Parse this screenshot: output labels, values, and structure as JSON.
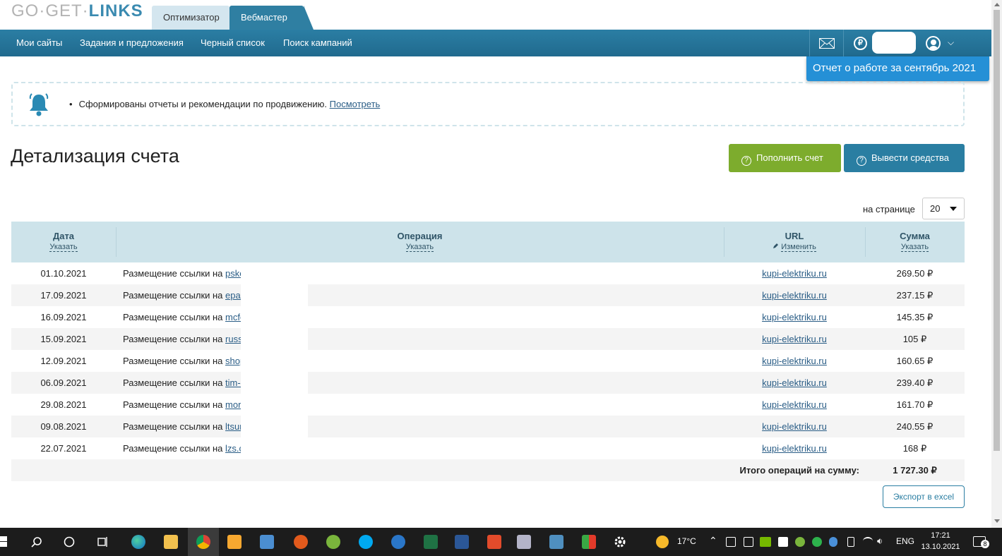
{
  "logo": {
    "part1": "GO·GET·",
    "part2": "LINKS"
  },
  "tabs": {
    "optimizer": "Оптимизатор",
    "webmaster": "Вебмастер"
  },
  "nav": [
    "Мои сайты",
    "Задания и предложения",
    "Черный список",
    "Поиск кампаний"
  ],
  "header_right": {
    "currency_symbol": "₽",
    "user_chevron": "⌵"
  },
  "report_popup": "Отчет о работе за сентябрь 2021",
  "notice": {
    "text": "Сформированы отчеты и рекомендации по продвижению.",
    "link": "Посмотреть"
  },
  "page_title": "Детализация счета",
  "buttons": {
    "topup": "Пополнить счет",
    "withdraw": "Вывести средства",
    "export": "Экспорт в excel"
  },
  "per_page": {
    "label": "на странице",
    "value": "20"
  },
  "table": {
    "headers": {
      "date": "Дата",
      "date_sub": "Указать",
      "operation": "Операция",
      "operation_sub": "Указать",
      "url": "URL",
      "url_sub": "Изменить",
      "sum": "Сумма",
      "sum_sub": "Указать"
    },
    "rows": [
      {
        "date": "01.10.2021",
        "op": "Размещение ссылки на ",
        "site": "psko",
        "url": "kupi-elektriku.ru",
        "sum": "269.50 ₽"
      },
      {
        "date": "17.09.2021",
        "op": "Размещение ссылки на ",
        "site": "epat",
        "url": "kupi-elektriku.ru",
        "sum": "237.15 ₽"
      },
      {
        "date": "16.09.2021",
        "op": "Размещение ссылки на ",
        "site": "mcfe",
        "url": "kupi-elektriku.ru",
        "sum": "145.35 ₽"
      },
      {
        "date": "15.09.2021",
        "op": "Размещение ссылки на ",
        "site": "russ",
        "url": "kupi-elektriku.ru",
        "sum": "105 ₽"
      },
      {
        "date": "12.09.2021",
        "op": "Размещение ссылки на ",
        "site": "shop",
        "url": "kupi-elektriku.ru",
        "sum": "160.65 ₽"
      },
      {
        "date": "06.09.2021",
        "op": "Размещение ссылки на ",
        "site": "tim-r",
        "url": "kupi-elektriku.ru",
        "sum": "239.40 ₽"
      },
      {
        "date": "29.08.2021",
        "op": "Размещение ссылки на ",
        "site": "more",
        "url": "kupi-elektriku.ru",
        "sum": "161.70 ₽"
      },
      {
        "date": "09.08.2021",
        "op": "Размещение ссылки на ",
        "site": "ltsur",
        "url": "kupi-elektriku.ru",
        "sum": "240.55 ₽"
      },
      {
        "date": "22.07.2021",
        "op": "Размещение ссылки на ",
        "site": "lzs.c",
        "url": "kupi-elektriku.ru",
        "sum": "168 ₽"
      }
    ],
    "total_label": "Итого операций на сумму:",
    "total_value": "1 727.30 ₽"
  },
  "taskbar": {
    "apps": [
      "start-icon",
      "search-icon",
      "cortana-icon",
      "task-view-icon",
      "edge-icon",
      "explorer-icon",
      "chrome-icon",
      "media-player-icon",
      "remote-icon",
      "scanner-icon",
      "utorrent-icon",
      "skype-icon",
      "globe-icon",
      "excel-icon",
      "word-icon",
      "acrobat-icon",
      "tool-icon",
      "notes-icon",
      "game-icon",
      "settings-icon"
    ],
    "temperature": "17°C",
    "lang": "ENG",
    "time": "17:21",
    "date": "13.10.2021",
    "notifications": "8"
  }
}
